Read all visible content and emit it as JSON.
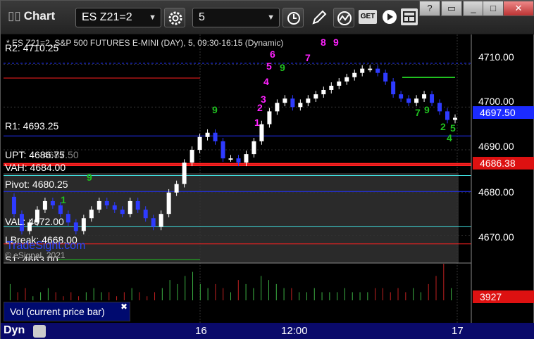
{
  "toolbar": {
    "title": "Chart",
    "symbol": "ES Z21=2",
    "interval": "5",
    "get_label": "GET",
    "minimize": "_",
    "maximize": "□",
    "close": "✕",
    "help": "?",
    "restore": "▭"
  },
  "legend": "* ES Z21=2, S&P 500 FUTURES E-MINI (DAY), 5, 09:30-16:15 (Dynamic)",
  "levels": {
    "r2": "R2: 4710.25",
    "r1": "R1: 4693.25",
    "upt": "UPT: 4686.75",
    "vah": "VAH: 4684.00",
    "pivot": "Pivot: 4680.25",
    "val": "VAL: 4672.00",
    "lbreak": "LBreak: 4668.00",
    "s1": "S1: 4663.00",
    "hidden": "4687.50"
  },
  "watermark": "TradeSight.com",
  "copyright": "© eSignal, 2021",
  "y_axis": {
    "ticks": [
      "4710.00",
      "4700.00",
      "4690.00",
      "4680.00",
      "4670.00"
    ],
    "last_price": "4697.50",
    "red_level": "4686.38",
    "volume_value": "3927"
  },
  "x_axis": {
    "labels": [
      "16",
      "12:00",
      "17"
    ],
    "mode": "Dyn"
  },
  "volume_panel": {
    "label": "Vol (current price bar)"
  },
  "colors": {
    "up_candle": "#ffffff",
    "down_candle": "#2e3bff",
    "pivot_line": "#2233ff",
    "red_line": "#ff2020",
    "cyan_line": "#40e0e0",
    "seq_magenta": "#ff22ff",
    "seq_green": "#20c020",
    "last_price_bg": "#1b2bff"
  },
  "chart_data": {
    "type": "line",
    "title": "* ES Z21=2, S&P 500 FUTURES E-MINI (DAY), 5, 09:30-16:15 (Dynamic)",
    "ylim": [
      4664,
      4717
    ],
    "price_path": [
      4679,
      4675,
      4671,
      4673,
      4676,
      4678,
      4677,
      4675,
      4673,
      4671,
      4674,
      4676,
      4678,
      4677,
      4676,
      4675,
      4678,
      4676,
      4674,
      4672,
      4675,
      4680,
      4682,
      4687,
      4690,
      4693,
      4694,
      4692,
      4688,
      4688,
      4687,
      4689,
      4692,
      4696,
      4699,
      4701,
      4702,
      4700,
      4701,
      4702,
      4703,
      4704,
      4705,
      4706,
      4707,
      4708,
      4709,
      4709,
      4708,
      4706,
      4703,
      4702,
      4701,
      4702,
      4703,
      4701,
      4699,
      4697,
      4697.5
    ],
    "volume": [
      4,
      2,
      3,
      1,
      2,
      3,
      2,
      1,
      2,
      1,
      2,
      3,
      2,
      2,
      1,
      2,
      3,
      2,
      1,
      2,
      3,
      5,
      4,
      6,
      7,
      4,
      3,
      4,
      3,
      2,
      5,
      4,
      3,
      6,
      5,
      4,
      3,
      3,
      2,
      2,
      3,
      2,
      2,
      2,
      3,
      2,
      2,
      2,
      3,
      3,
      2,
      3,
      2,
      3,
      2,
      4,
      6,
      9,
      3
    ]
  }
}
